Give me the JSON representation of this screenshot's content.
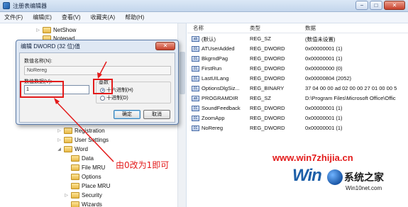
{
  "window": {
    "title": "注册表编辑器",
    "min_label": "−",
    "max_label": "□",
    "close_label": "✕"
  },
  "menu": [
    "文件(F)",
    "编辑(E)",
    "查看(V)",
    "收藏夹(A)",
    "帮助(H)"
  ],
  "tree": {
    "items": [
      {
        "label": "NetShow",
        "expander": "▷"
      },
      {
        "label": "Notepad",
        "expander": ""
      },
      {
        "label": "Registration",
        "expander": "▷"
      },
      {
        "label": "User Settings",
        "expander": "▷"
      },
      {
        "label": "Word",
        "expander": "◢"
      },
      {
        "label": "Data",
        "expander": ""
      },
      {
        "label": "File MRU",
        "expander": ""
      },
      {
        "label": "Options",
        "expander": ""
      },
      {
        "label": "Place MRU",
        "expander": ""
      },
      {
        "label": "Security",
        "expander": "▷"
      },
      {
        "label": "Wizards",
        "expander": ""
      }
    ]
  },
  "values": {
    "headers": {
      "name": "名称",
      "type": "类型",
      "data": "数据"
    },
    "rows": [
      {
        "icon": "ab",
        "name": "(默认)",
        "type": "REG_SZ",
        "data": "(数值未设置)"
      },
      {
        "icon": "01",
        "name": "ATUserAdded",
        "type": "REG_DWORD",
        "data": "0x00000001 (1)"
      },
      {
        "icon": "01",
        "name": "BkgrndPag",
        "type": "REG_DWORD",
        "data": "0x00000001 (1)"
      },
      {
        "icon": "01",
        "name": "FirstRun",
        "type": "REG_DWORD",
        "data": "0x00000000 (0)"
      },
      {
        "icon": "01",
        "name": "LastUILang",
        "type": "REG_DWORD",
        "data": "0x00000804 (2052)"
      },
      {
        "icon": "01",
        "name": "OptionsDlgSiz...",
        "type": "REG_BINARY",
        "data": "37 04 00 00 ad 02 00 00 27 01 00 00 5"
      },
      {
        "icon": "ab",
        "name": "PROGRAMDIR",
        "type": "REG_SZ",
        "data": "D:\\Program Files\\Microsoft Office\\Offic"
      },
      {
        "icon": "01",
        "name": "SoundFeedback",
        "type": "REG_DWORD",
        "data": "0x00000001 (1)"
      },
      {
        "icon": "01",
        "name": "ZoomApp",
        "type": "REG_DWORD",
        "data": "0x00000001 (1)"
      },
      {
        "icon": "01",
        "name": "NoRereg",
        "type": "REG_DWORD",
        "data": "0x00000001 (1)"
      }
    ]
  },
  "dialog": {
    "title": "编辑 DWORD (32 位)值",
    "close_label": "✕",
    "name_label": "数值名称(N):",
    "name_value": "NoRereg",
    "data_label": "数值数据(V):",
    "data_value": "1",
    "base_label": "基数",
    "radix_hex": "十六进制(H)",
    "radix_dec": "十进制(D)",
    "ok_label": "确定",
    "cancel_label": "取消"
  },
  "annotation": {
    "text": "由0改为1即可",
    "color": "#e31b1b"
  },
  "watermark": {
    "url": "www.win7zhijia.cn",
    "logo_text": "Win",
    "site_name": "系统之家",
    "site_url": "Win10net.com"
  }
}
